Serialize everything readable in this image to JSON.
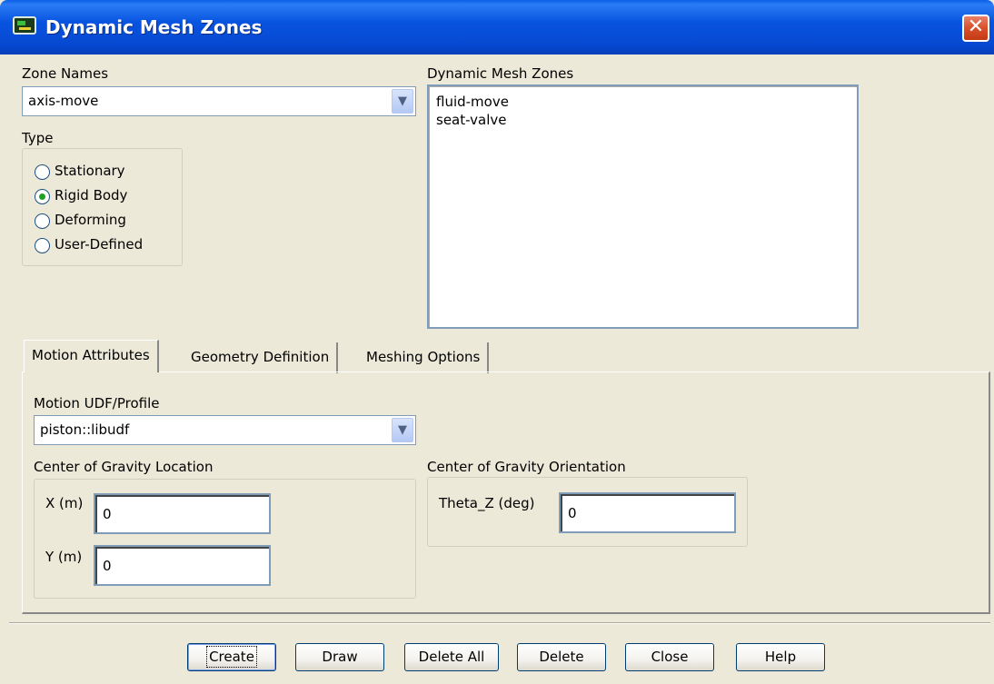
{
  "window": {
    "title": "Dynamic Mesh Zones",
    "close_glyph": "✕"
  },
  "zone_names": {
    "label": "Zone Names",
    "selected": "axis-move"
  },
  "type_group": {
    "label": "Type",
    "options": [
      {
        "label": "Stationary",
        "checked": false
      },
      {
        "label": "Rigid Body",
        "checked": true
      },
      {
        "label": "Deforming",
        "checked": false
      },
      {
        "label": "User-Defined",
        "checked": false
      }
    ]
  },
  "dynamic_zones": {
    "label": "Dynamic Mesh Zones",
    "items": [
      "fluid-move",
      "seat-valve"
    ]
  },
  "tabs": [
    {
      "label": "Motion Attributes",
      "active": true
    },
    {
      "label": "Geometry Definition",
      "active": false
    },
    {
      "label": "Meshing Options",
      "active": false
    }
  ],
  "motion": {
    "udf_label": "Motion UDF/Profile",
    "udf_selected": "piston::libudf",
    "cog_location": {
      "label": "Center of Gravity Location",
      "x_label": "X (m)",
      "x_value": "0",
      "y_label": "Y (m)",
      "y_value": "0"
    },
    "cog_orientation": {
      "label": "Center of Gravity Orientation",
      "theta_label": "Theta_Z (deg)",
      "theta_value": "0"
    }
  },
  "buttons": {
    "create": "Create",
    "draw": "Draw",
    "delete_all": "Delete All",
    "delete": "Delete",
    "close": "Close",
    "help": "Help"
  },
  "icons": {
    "dropdown": "chevron-down-icon",
    "close": "close-icon",
    "app": "app-icon"
  },
  "colors": {
    "titlebar": "#0854e0",
    "face": "#ece9d8",
    "close": "#d8502a",
    "radio_dot": "#21a121"
  }
}
